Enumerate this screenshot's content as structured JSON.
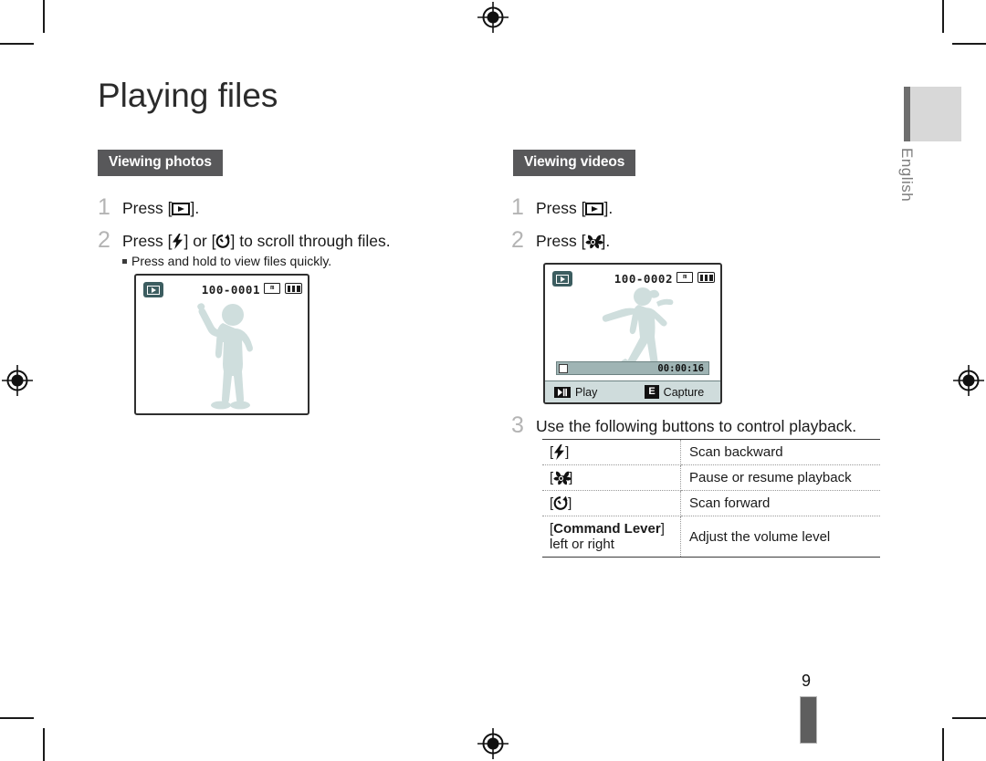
{
  "page": {
    "title": "Playing files",
    "number": "9",
    "language": "English"
  },
  "left_column": {
    "section_label": "Viewing photos",
    "steps": [
      {
        "num": "1",
        "text_before": "Press [",
        "icon": "playback-icon",
        "text_after": "]."
      },
      {
        "num": "2",
        "text_before": "Press [",
        "icon1": "flash-icon",
        "text_middle": "] or [",
        "icon2": "timer-icon",
        "text_after": "] to scroll through files.",
        "substep": "Press and hold to view files quickly."
      }
    ],
    "lcd": {
      "mode_icon": "playback-mode-icon",
      "file_number": "100-0001",
      "card_icon": "memory-card-icon",
      "card_label": "m",
      "battery_icon": "battery-full-icon",
      "subject": "person-silhouette"
    }
  },
  "right_column": {
    "section_label": "Viewing videos",
    "steps": [
      {
        "num": "1",
        "text_before": "Press [",
        "icon": "playback-icon",
        "text_after": "]."
      },
      {
        "num": "2",
        "text_before": "Press [",
        "icon": "macro-icon",
        "text_after": "]."
      },
      {
        "num": "3",
        "text": "Use the following buttons to control playback."
      }
    ],
    "lcd": {
      "mode_icon": "playback-mode-icon",
      "file_number": "100-0002",
      "card_icon": "memory-card-icon",
      "card_label": "m",
      "battery_icon": "battery-full-icon",
      "subject": "dancer-silhouette",
      "elapsed_time": "00:00:16",
      "buttons": [
        {
          "key_icon": "play-pause-icon",
          "label": "Play"
        },
        {
          "key_icon": "e-button-icon",
          "key_text": "E",
          "label": "Capture"
        }
      ]
    },
    "control_table": {
      "rows": [
        {
          "key_icon": "flash-icon",
          "key_prefix": "[",
          "key_suffix": "]",
          "action": "Scan backward"
        },
        {
          "key_icon": "macro-icon",
          "key_prefix": "[",
          "key_suffix": "]",
          "action": "Pause or resume playback"
        },
        {
          "key_icon": "timer-icon",
          "key_prefix": "[",
          "key_suffix": "]",
          "action": "Scan forward"
        },
        {
          "key_bold": "Command Lever",
          "key_prefix": "[",
          "key_suffix": "]",
          "key_sub": "left or right",
          "action": "Adjust the volume level"
        }
      ]
    }
  },
  "colors": {
    "badge_bg": "#58585a",
    "step_num": "#b4b4b4",
    "lcd_border": "#2f2f2f",
    "lcd_teal": "#3c5d60",
    "silhouette": "#cfdedd",
    "tab_block": "#d8d8d8",
    "tab_bar": "#6e6e6e"
  }
}
